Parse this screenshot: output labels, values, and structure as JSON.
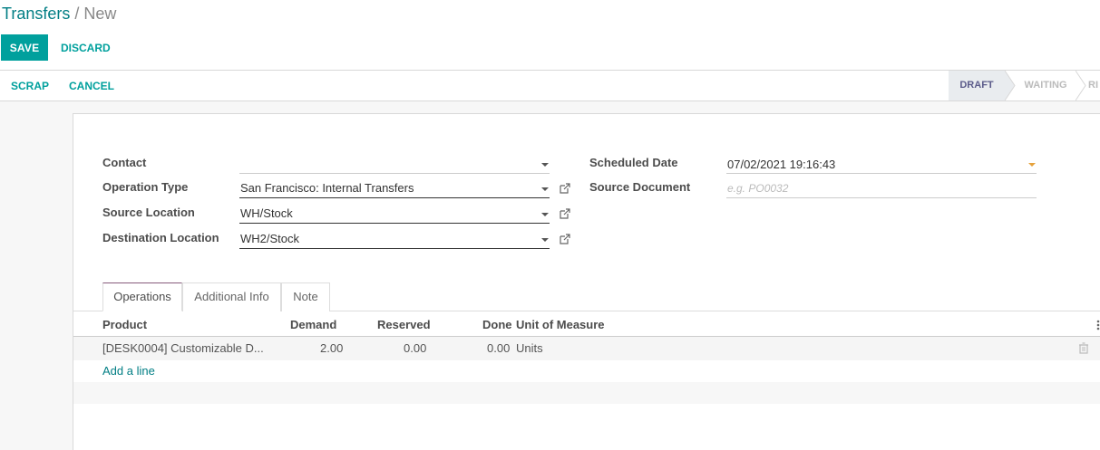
{
  "breadcrumb": {
    "parent": "Transfers",
    "separator": "/",
    "current": "New"
  },
  "actions": {
    "save_label": "SAVE",
    "discard_label": "DISCARD"
  },
  "statusbar": {
    "buttons": {
      "scrap": "SCRAP",
      "cancel": "CANCEL"
    },
    "stages": [
      "DRAFT",
      "WAITING",
      "RI"
    ],
    "active_stage": "DRAFT"
  },
  "form": {
    "left": {
      "contact": {
        "label": "Contact",
        "value": ""
      },
      "operation_type": {
        "label": "Operation Type",
        "value": "San Francisco: Internal Transfers"
      },
      "source_location": {
        "label": "Source Location",
        "value": "WH/Stock"
      },
      "destination_location": {
        "label": "Destination Location",
        "value": "WH2/Stock"
      }
    },
    "right": {
      "scheduled_date": {
        "label": "Scheduled Date",
        "value": "07/02/2021 19:16:43"
      },
      "source_document": {
        "label": "Source Document",
        "value": "",
        "placeholder": "e.g. PO0032"
      }
    }
  },
  "tabs": [
    "Operations",
    "Additional Info",
    "Note"
  ],
  "active_tab": "Operations",
  "operations_table": {
    "columns": {
      "product": "Product",
      "demand": "Demand",
      "reserved": "Reserved",
      "done": "Done",
      "uom": "Unit of Measure"
    },
    "rows": [
      {
        "product": "[DESK0004] Customizable D...",
        "demand": "2.00",
        "reserved": "0.00",
        "done": "0.00",
        "uom": "Units"
      }
    ],
    "add_line_label": "Add a line"
  },
  "colors": {
    "primary": "#00a09d",
    "link": "#017e84",
    "status_active_bg": "#e9ecef"
  },
  "icons": {
    "dropdown": "caret-down-icon",
    "external": "external-link-icon",
    "delete": "trash-icon",
    "options": "column-options-icon"
  }
}
